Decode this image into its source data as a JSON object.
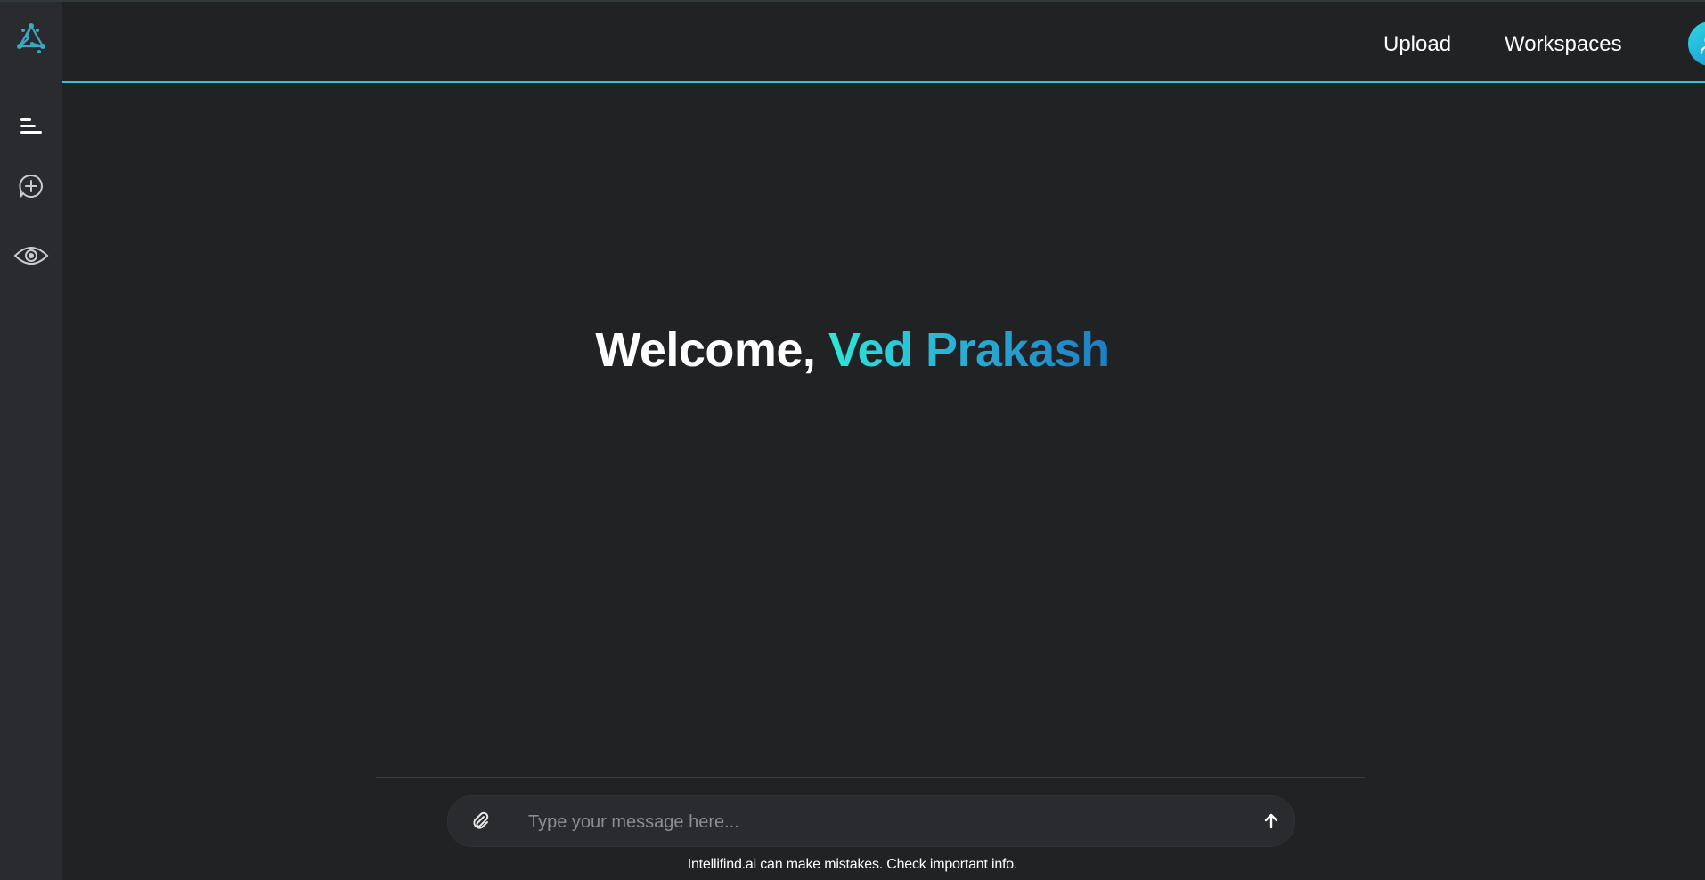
{
  "header": {
    "nav": {
      "upload_label": "Upload",
      "workspaces_label": "Workspaces"
    },
    "avatar_icon": "user-icon"
  },
  "sidebar": {
    "logo_icon": "intellifind-logo-icon",
    "items": [
      {
        "icon": "menu-icon"
      },
      {
        "icon": "new-chat-icon"
      },
      {
        "icon": "eye-icon"
      }
    ]
  },
  "main": {
    "welcome_prefix": "Welcome,",
    "user_name": "Ved Prakash"
  },
  "composer": {
    "placeholder": "Type your message here...",
    "value": "",
    "attach_icon": "paperclip-icon",
    "send_icon": "arrow-up-icon"
  },
  "footer": {
    "disclaimer": "Intellifind.ai can make mistakes. Check important info."
  },
  "colors": {
    "background": "#212224",
    "sidebar": "#2a2b2e",
    "accent": "#36bfe0",
    "name_gradient_start": "#2ee6d8",
    "name_gradient_end": "#1e7dc4"
  }
}
